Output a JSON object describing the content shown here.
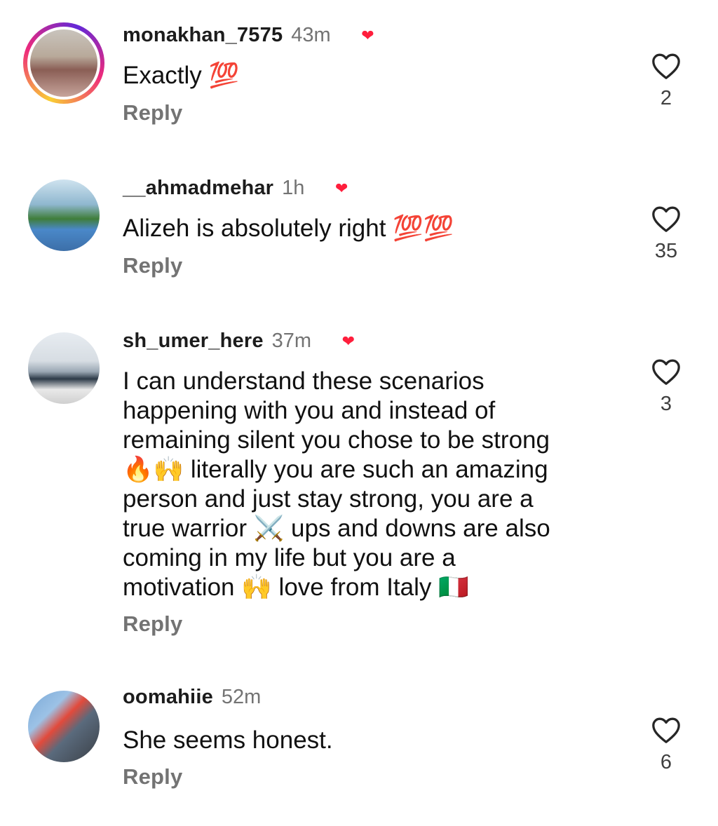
{
  "comments": [
    {
      "username": "monakhan_7575",
      "time": "43m",
      "text": "Exactly 💯",
      "reply": "Reply",
      "likes": "2",
      "story_ring": true
    },
    {
      "username": "__ahmadmehar",
      "time": "1h",
      "text": "Alizeh is absolutely right 💯💯",
      "reply": "Reply",
      "likes": "35",
      "story_ring": false
    },
    {
      "username": "sh_umer_here",
      "time": "37m",
      "text": "I can understand these scenarios\nhappening with you and instead of\nremaining silent you chose to be strong\n🔥🙌 literally you are such an amazing\nperson and just stay strong, you are a\ntrue warrior ⚔️ ups and downs are also\ncoming in my life but you are a\nmotivation 🙌 love from Italy 🇮🇹",
      "reply": "Reply",
      "likes": "3",
      "story_ring": false
    },
    {
      "username": "oomahiie",
      "time": "52m",
      "text": "She seems honest.",
      "reply": "Reply",
      "likes": "6",
      "story_ring": false
    }
  ],
  "icons": {
    "like": "heart-outline-icon",
    "creator_liked": "creator-liked-heart-icon"
  },
  "colors": {
    "secondary_text": "#737373",
    "creator_heart": "#ff1e3c"
  }
}
